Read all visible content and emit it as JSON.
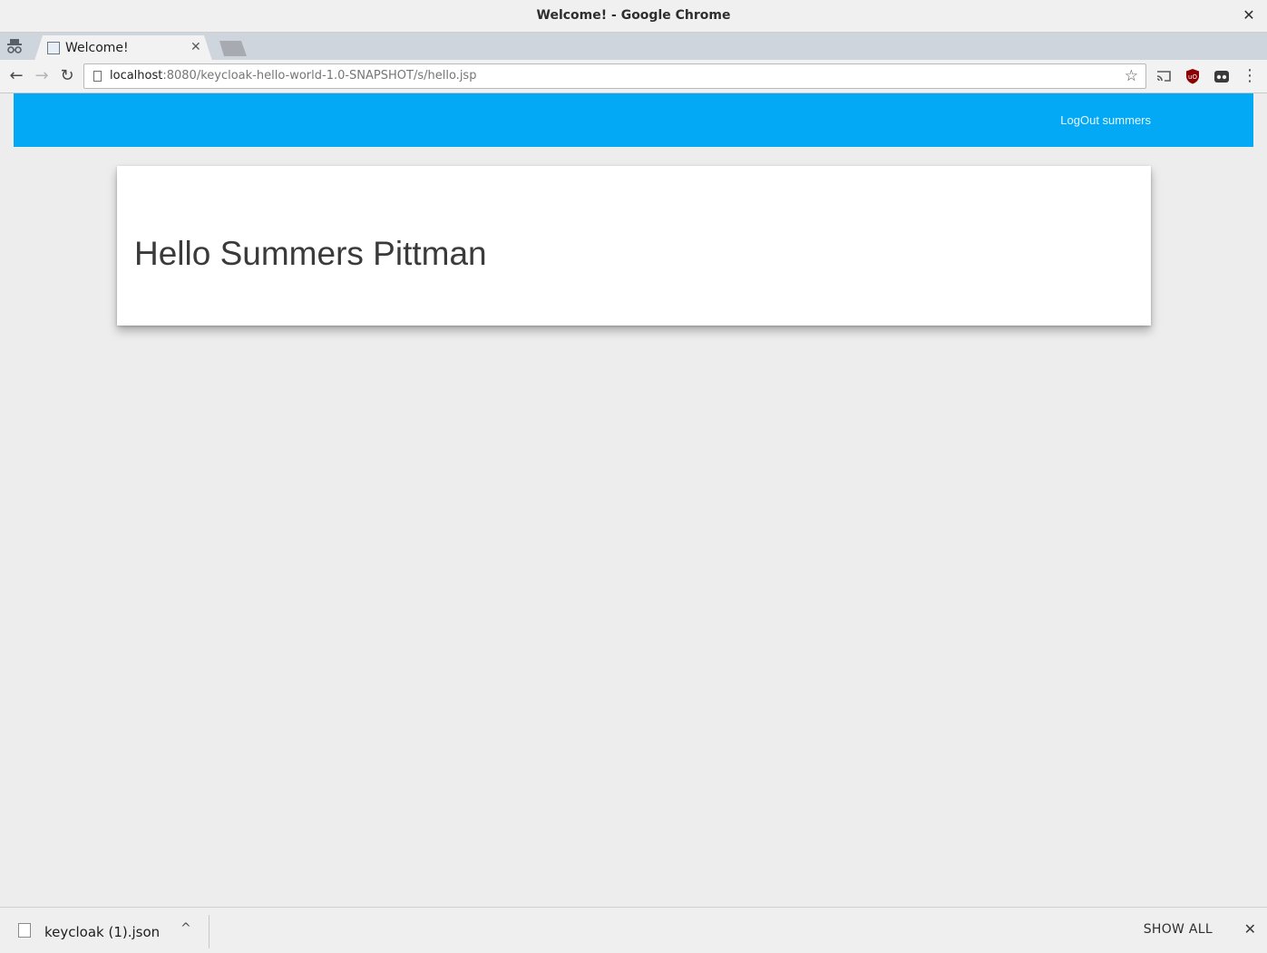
{
  "window": {
    "title": "Welcome! - Google Chrome",
    "close_glyph": "✕"
  },
  "tabs": [
    {
      "title": "Welcome!",
      "close_glyph": "✕"
    }
  ],
  "toolbar": {
    "back_glyph": "←",
    "forward_glyph": "→",
    "reload_glyph": "↻",
    "url_host": "localhost",
    "url_rest": ":8080/keycloak-hello-world-1.0-SNAPSHOT/s/hello.jsp",
    "star_glyph": "☆",
    "menu_glyph": "⋮",
    "extensions": [
      "cast-icon",
      "ublock-origin-icon",
      "incognito-extension-icon"
    ]
  },
  "page": {
    "appbar": {
      "logout_label": "LogOut summers",
      "color": "#03a9f4"
    },
    "greeting": "Hello Summers Pittman"
  },
  "downloads": {
    "file_name": "keycloak (1).json",
    "caret_glyph": "^",
    "show_all_label": "SHOW ALL",
    "close_glyph": "✕"
  }
}
